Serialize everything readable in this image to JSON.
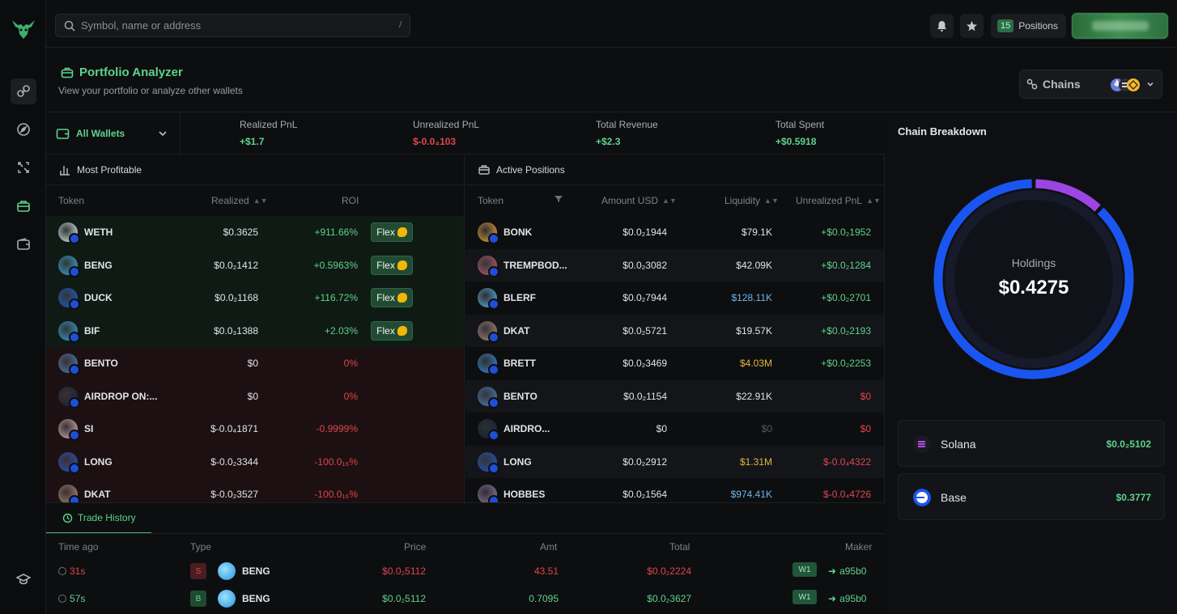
{
  "search": {
    "placeholder": "Symbol, name or address",
    "shortcut": "/"
  },
  "topbar": {
    "positions_count": "15",
    "positions_label": "Positions"
  },
  "page": {
    "title": "Portfolio Analyzer",
    "subtitle": "View your portfolio or analyze other wallets",
    "chains_label": "Chains"
  },
  "stats": {
    "wallet_selector": "All Wallets",
    "realized_label": "Realized PnL",
    "realized_value": "+$1.7",
    "unrealized_label": "Unrealized PnL",
    "unrealized_value": "$-0.0₄103",
    "revenue_label": "Total Revenue",
    "revenue_value": "+$2.3",
    "spent_label": "Total Spent",
    "spent_value": "+$0.5918"
  },
  "most_profitable": {
    "title": "Most Profitable",
    "headers": {
      "token": "Token",
      "realized": "Realized",
      "roi": "ROI"
    },
    "flex_label": "Flex",
    "rows": [
      {
        "token": "WETH",
        "realized": "$0.3625",
        "roi": "+911.66%",
        "kind": "gain",
        "color": "#e8eef8"
      },
      {
        "token": "BENG",
        "realized": "$0.0₂1412",
        "roi": "+0.5963%",
        "kind": "gain",
        "color": "#3aa7e8"
      },
      {
        "token": "DUCK",
        "realized": "$0.0₂1168",
        "roi": "+116.72%",
        "kind": "gain",
        "color": "#2157d6"
      },
      {
        "token": "BIF",
        "realized": "$0.0₃1388",
        "roi": "+2.03%",
        "kind": "gain",
        "color": "#3aa0e0"
      },
      {
        "token": "BENTO",
        "realized": "$0",
        "roi": "0%",
        "kind": "loss",
        "color": "#4a7fb8"
      },
      {
        "token": "AIRDROP ON:...",
        "realized": "$0",
        "roi": "0%",
        "kind": "loss",
        "color": "#12223a"
      },
      {
        "token": "SI",
        "realized": "$-0.0₄1871",
        "roi": "-0.9999%",
        "kind": "loss",
        "color": "#d9b3b8"
      },
      {
        "token": "LONG",
        "realized": "$-0.0₂3344",
        "roi": "-100.0₁₆%",
        "kind": "loss",
        "color": "#1f55c8"
      },
      {
        "token": "DKAT",
        "realized": "$-0.0₂3527",
        "roi": "-100.0₁₆%",
        "kind": "loss",
        "color": "#b08a76"
      }
    ]
  },
  "active_positions": {
    "title": "Active Positions",
    "headers": {
      "token": "Token",
      "amount": "Amount USD",
      "liquidity": "Liquidity",
      "unrealized": "Unrealized PnL"
    },
    "rows": [
      {
        "token": "BONK",
        "amount": "$0.0₂1944",
        "liquidity": "$79.1K",
        "liq_color": "white",
        "pnl": "+$0.0₂1952",
        "pnl_color": "green",
        "color": "#f2a53a"
      },
      {
        "token": "TREMPBOD...",
        "amount": "$0.0₂3082",
        "liquidity": "$42.09K",
        "liq_color": "white",
        "pnl": "+$0.0₂1284",
        "pnl_color": "green",
        "color": "#c45a6b"
      },
      {
        "token": "BLERF",
        "amount": "$0.0₂7944",
        "liquidity": "$128.11K",
        "liq_color": "blue",
        "pnl": "+$0.0₂2701",
        "pnl_color": "green",
        "color": "#58b8e8"
      },
      {
        "token": "DKAT",
        "amount": "$0.0₂5721",
        "liquidity": "$19.57K",
        "liq_color": "white",
        "pnl": "+$0.0₂2193",
        "pnl_color": "green",
        "color": "#b08a76"
      },
      {
        "token": "BRETT",
        "amount": "$0.0₂3469",
        "liquidity": "$4.03M",
        "liq_color": "yellow",
        "pnl": "+$0.0₂2253",
        "pnl_color": "green",
        "color": "#3a8ad8"
      },
      {
        "token": "BENTO",
        "amount": "$0.0₂1154",
        "liquidity": "$22.91K",
        "liq_color": "white",
        "pnl": "$0",
        "pnl_color": "red",
        "color": "#4a7fb8"
      },
      {
        "token": "AIRDRO...",
        "amount": "$0",
        "liquidity": "$0",
        "liq_color": "dim",
        "pnl": "$0",
        "pnl_color": "red",
        "color": "#12223a"
      },
      {
        "token": "LONG",
        "amount": "$0.0₂2912",
        "liquidity": "$1.31M",
        "liq_color": "yellow",
        "pnl": "$-0.0₄4322",
        "pnl_color": "red",
        "color": "#1f55c8"
      },
      {
        "token": "HOBBES",
        "amount": "$0.0₂1564",
        "liquidity": "$974.41K",
        "liq_color": "blue",
        "pnl": "$-0.0₄4726",
        "pnl_color": "red",
        "color": "#9a7aa8"
      }
    ]
  },
  "trade_history": {
    "tab_label": "Trade History",
    "headers": {
      "time": "Time ago",
      "type": "Type",
      "price": "Price",
      "amt": "Amt",
      "total": "Total",
      "maker": "Maker"
    },
    "rows": [
      {
        "time": "31s",
        "type": "S",
        "token": "BENG",
        "price": "$0.0₂5112",
        "amt": "43.51",
        "total": "$0.0₂2224",
        "wallet": "W1",
        "maker": "a95b0",
        "side": "sell"
      },
      {
        "time": "57s",
        "type": "B",
        "token": "BENG",
        "price": "$0.0₂5112",
        "amt": "0.7095",
        "total": "$0.0₂3627",
        "wallet": "W1",
        "maker": "a95b0",
        "side": "buy"
      }
    ]
  },
  "chain_breakdown": {
    "title": "Chain Breakdown",
    "holdings_label": "Holdings",
    "holdings_value": "$0.4275",
    "chains": [
      {
        "name": "Solana",
        "value": "$0.0₂5102",
        "share": 0.12,
        "color": "#9b45e4"
      },
      {
        "name": "Base",
        "value": "$0.3777",
        "share": 0.88,
        "color": "#1a55f0"
      }
    ]
  },
  "colors": {
    "accent": "#5fd38d",
    "negative": "#e0454f",
    "base_blue": "#1a55f0",
    "solana_purple": "#9b45e4"
  }
}
